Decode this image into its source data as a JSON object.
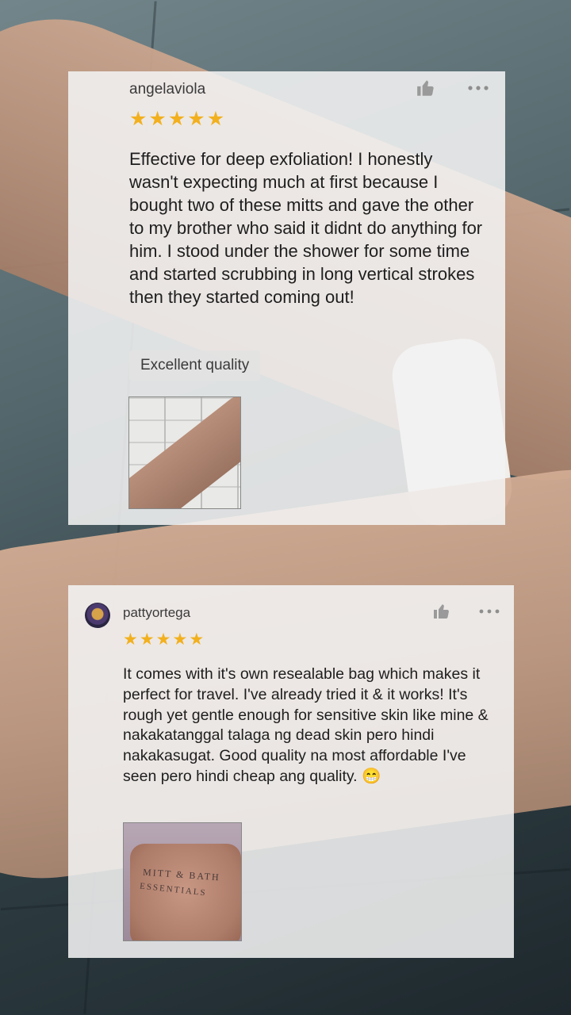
{
  "reviews": [
    {
      "username": "angelaviola",
      "rating": 5,
      "text": "Effective for deep exfoliation! I honestly wasn't expecting much at first because I bought two of these mitts and gave the other to my brother who said it didnt do anything for him. I stood under the shower for some time and started scrubbing in long vertical strokes then they started coming out!",
      "tag": "Excellent quality"
    },
    {
      "username": "pattyortega",
      "rating": 5,
      "text": "It comes with it's own resealable bag which makes it perfect for travel. I've already tried it & it works! It's rough yet gentle enough for sensitive skin like mine & nakakatanggal talaga ng dead skin pero hindi nakakasugat. Good quality na most affordable I've seen pero hindi cheap ang quality. 😁",
      "photo_text_line1": "MITT & BATH",
      "photo_text_line2": "ESSENTIALS"
    }
  ],
  "icons": {
    "like": "thumbs-up-icon",
    "more": "more-options-icon",
    "star": "star-icon"
  },
  "colors": {
    "star": "#f2b01e",
    "card_bg": "#f3f3f3"
  }
}
